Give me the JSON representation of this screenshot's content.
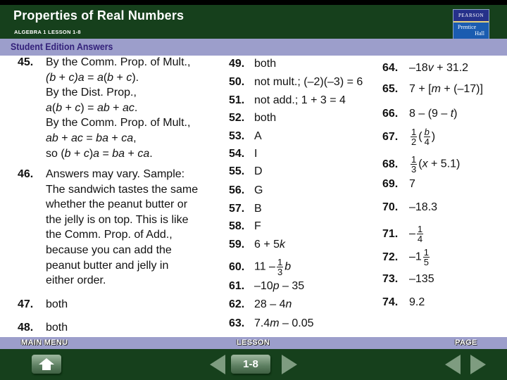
{
  "header": {
    "title": "Properties of Real Numbers",
    "subtitle": "ALGEBRA 1  LESSON 1-8",
    "logo_top": "PEARSON",
    "logo_line1": "Prentice",
    "logo_line2": "Hall"
  },
  "section_title": "Student Edition Answers",
  "answers": {
    "a45": {
      "num": "45.",
      "lines": [
        "By the Comm. Prop. of Mult.,",
        "(b + c)a = a(b + c).",
        "By the Dist. Prop.,",
        "a(b + c) = ab + ac.",
        "By the Comm. Prop. of Mult.,",
        "ab + ac = ba + ca,",
        "so (b + c)a = ba + ca."
      ]
    },
    "a46": {
      "num": "46.",
      "lines": [
        "Answers may vary. Sample:",
        "The sandwich tastes the same",
        "whether the peanut butter or",
        "the jelly is on top. This is like",
        "the Comm. Prop. of Add.,",
        "because you can add the",
        "peanut butter and jelly in",
        "either order."
      ]
    },
    "a47": {
      "num": "47.",
      "text": "both"
    },
    "a48": {
      "num": "48.",
      "text": "both"
    },
    "a49": {
      "num": "49.",
      "text": "both"
    },
    "a50": {
      "num": "50.",
      "text": "not mult.; (–2)(–3) = 6"
    },
    "a51": {
      "num": "51.",
      "text": "not add.; 1 + 3 = 4"
    },
    "a52": {
      "num": "52.",
      "text": "both"
    },
    "a53": {
      "num": "53.",
      "text": "A"
    },
    "a54": {
      "num": "54.",
      "text": "I"
    },
    "a55": {
      "num": "55.",
      "text": "D"
    },
    "a56": {
      "num": "56.",
      "text": "G"
    },
    "a57": {
      "num": "57.",
      "text": "B"
    },
    "a58": {
      "num": "58.",
      "text": "F"
    },
    "a59": {
      "num": "59.",
      "pre": "6 + 5",
      "var": "k"
    },
    "a60": {
      "num": "60.",
      "pre": "11 –",
      "frac_n": "1",
      "frac_d": "3",
      "var": "b"
    },
    "a61": {
      "num": "61.",
      "pre": "–10",
      "var": "p",
      "post": " – 35"
    },
    "a62": {
      "num": "62.",
      "pre": "28 – 4",
      "var": "n"
    },
    "a63": {
      "num": "63.",
      "pre": "7.4",
      "var": "m",
      "post": " – 0.05"
    },
    "a64": {
      "num": "64.",
      "pre": "–18",
      "var": "v",
      "post": " + 31.2"
    },
    "a65": {
      "num": "65.",
      "pre": "7 + [",
      "var": "m",
      "post": " + (–17)]"
    },
    "a66": {
      "num": "66.",
      "pre": "8 – (9 – ",
      "var": "t",
      "post": ")"
    },
    "a67": {
      "num": "67.",
      "frac_n": "1",
      "frac_d": "2",
      "open": "(",
      "inner_n": "b",
      "inner_d": "4",
      "close": ")"
    },
    "a68": {
      "num": "68.",
      "frac_n": "1",
      "frac_d": "3",
      "pre": "(",
      "var": "x",
      "post": " + 5.1)"
    },
    "a69": {
      "num": "69.",
      "text": "7"
    },
    "a70": {
      "num": "70.",
      "text": "–18.3"
    },
    "a71": {
      "num": "71.",
      "pre": "–",
      "frac_n": "1",
      "frac_d": "4"
    },
    "a72": {
      "num": "72.",
      "pre": "–1",
      "frac_n": "1",
      "frac_d": "5"
    },
    "a73": {
      "num": "73.",
      "text": "–135"
    },
    "a74": {
      "num": "74.",
      "text": "9.2"
    }
  },
  "footer": {
    "main_menu_label": "MAIN MENU",
    "lesson_label": "LESSON",
    "page_label": "PAGE",
    "lesson_number": "1-8",
    "home_icon": "home-icon",
    "prev_icon": "triangle-left-icon",
    "next_icon": "triangle-right-icon"
  },
  "colors": {
    "header_bg": "#16401c",
    "band_bg": "#9c9ecb",
    "band_text": "#33217a"
  }
}
